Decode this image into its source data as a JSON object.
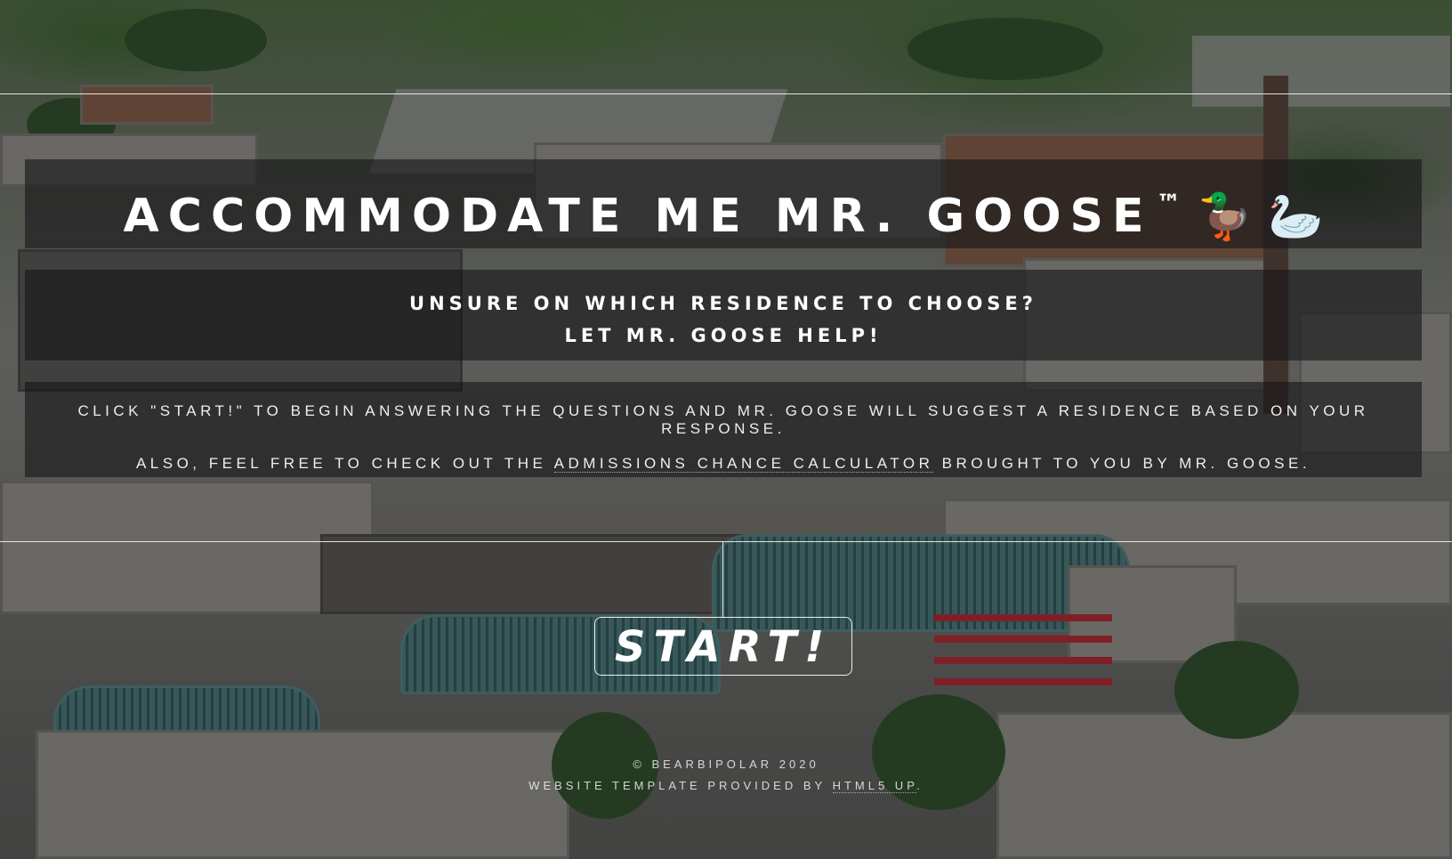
{
  "header": {
    "title": "ACCOMMODATE ME MR. GOOSE",
    "trademark": "™",
    "emojis": "🦆 🦢"
  },
  "subtitle": {
    "line1": "UNSURE ON WHICH RESIDENCE TO CHOOSE?",
    "line2": "LET MR. GOOSE HELP!"
  },
  "intro": {
    "line1": "CLICK \"START!\" TO BEGIN ANSWERING THE QUESTIONS AND MR. GOOSE WILL SUGGEST A RESIDENCE BASED ON YOUR RESPONSE.",
    "line2_prefix": "ALSO, FEEL FREE TO CHECK OUT THE",
    "calculator_link": "ADMISSIONS CHANCE CALCULATOR",
    "line2_suffix": "BROUGHT TO YOU BY MR. GOOSE."
  },
  "actions": {
    "start_label": "START!"
  },
  "footer": {
    "copyright": "© BEARBIPOLAR 2020",
    "credit_prefix": "WEBSITE TEMPLATE PROVIDED BY",
    "credit_link": "HTML5 UP",
    "credit_suffix": "."
  },
  "colors": {
    "text": "#ffffff",
    "panel_bg": "#161618"
  }
}
